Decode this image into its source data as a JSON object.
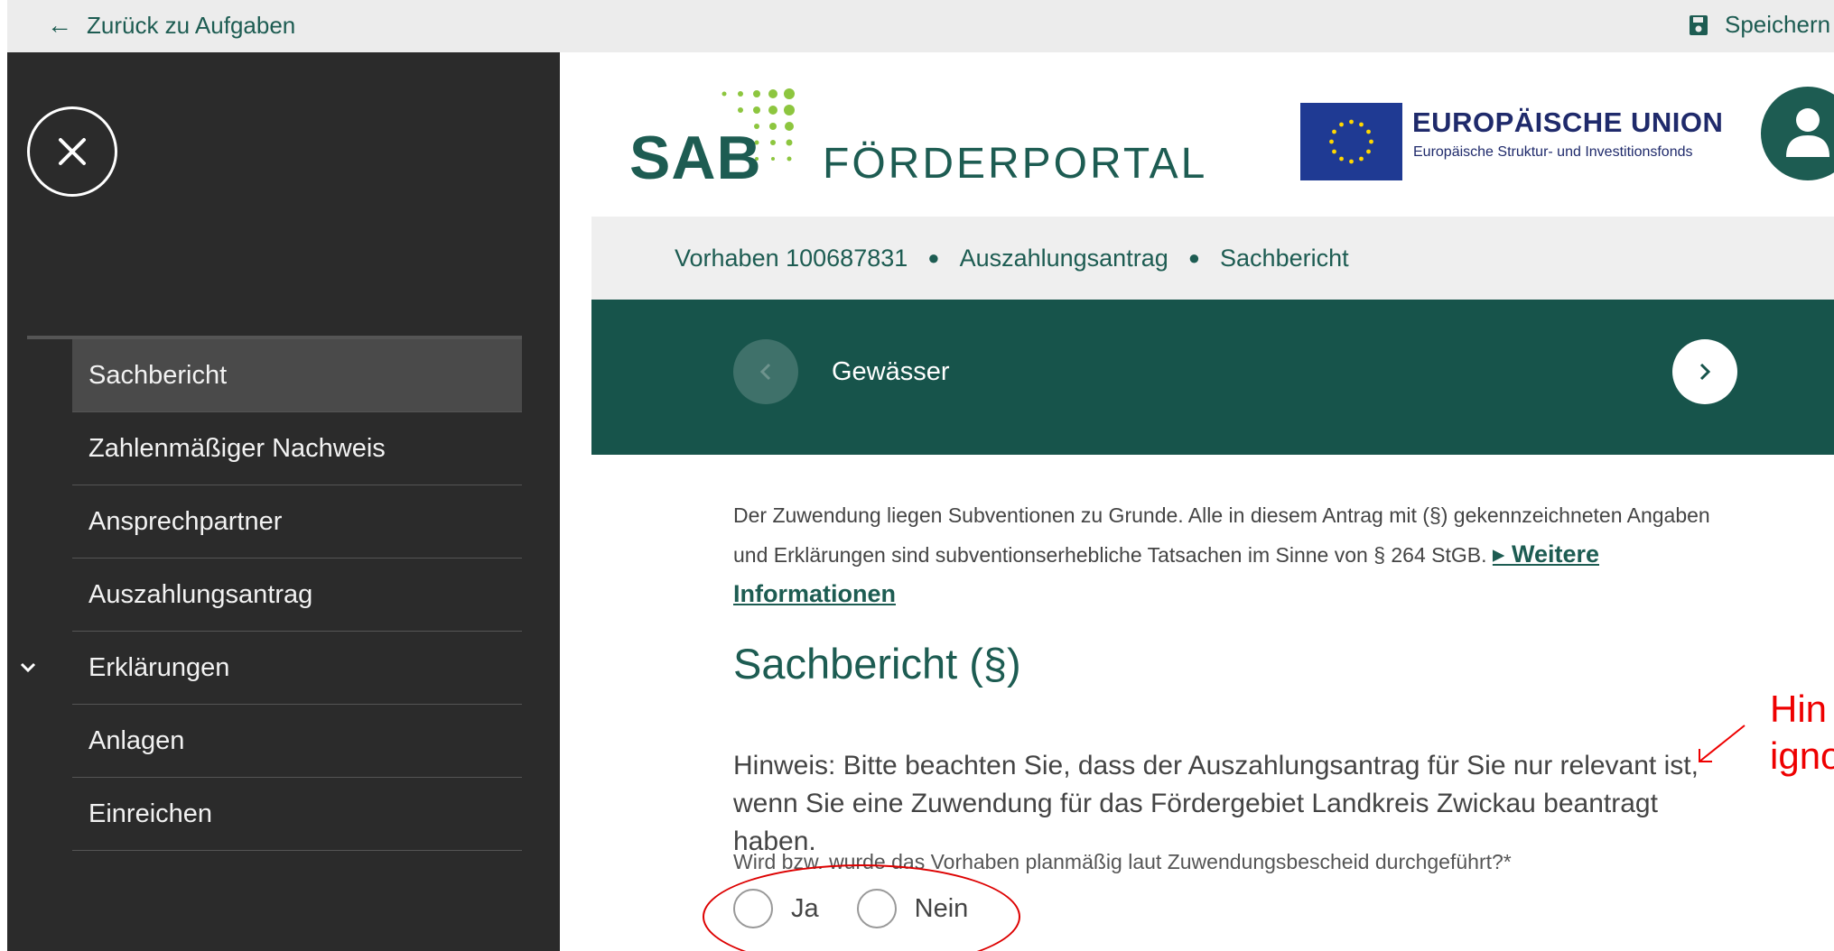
{
  "topbar": {
    "back_label": "Zurück zu Aufgaben",
    "save_label": "Speichern"
  },
  "sidebar": {
    "items": [
      {
        "label": "Sachbericht",
        "active": true
      },
      {
        "label": "Zahlenmäßiger Nachweis"
      },
      {
        "label": "Ansprechpartner"
      },
      {
        "label": "Auszahlungsantrag"
      },
      {
        "label": "Erklärungen",
        "expandable": true
      },
      {
        "label": "Anlagen"
      },
      {
        "label": "Einreichen"
      }
    ]
  },
  "header": {
    "logo_sab": "SAB",
    "logo_portal": "FÖRDERPORTAL",
    "eu_title": "EUROPÄISCHE UNION",
    "eu_subtitle": "Europäische Struktur- und Investitionsfonds"
  },
  "breadcrumb": {
    "items": [
      "Vorhaben 100687831",
      "Auszahlungsantrag",
      "Sachbericht"
    ]
  },
  "section": {
    "title": "Gewässer"
  },
  "content": {
    "notice_text": "Der Zuwendung liegen Subventionen zu Grunde. Alle in diesem Antrag mit (§) gekennzeichneten Angaben und Erklärungen sind subventionserhebliche Tatsachen im Sinne von § 264 StGB.",
    "notice_link": "▸ Weitere Informationen",
    "page_title": "Sachbericht (§)",
    "hint": "Hinweis: Bitte beachten Sie, dass der Auszahlungsantrag für Sie nur relevant ist, wenn Sie eine Zuwendung für das Fördergebiet Landkreis Zwickau beantragt haben.",
    "question": "Wird bzw. wurde das Vorhaben planmäßig laut Zuwendungsbescheid durchgeführt?*",
    "options": [
      "Ja",
      "Nein"
    ]
  },
  "annotation": {
    "line1": "Hin",
    "line2": "igno",
    "color": "#e00000"
  },
  "colors": {
    "brand": "#1d5c52",
    "section_bar": "#17544b",
    "sidebar_bg": "#2b2b2b",
    "eu_blue": "#1f3a93",
    "eu_star": "#ffd700"
  }
}
